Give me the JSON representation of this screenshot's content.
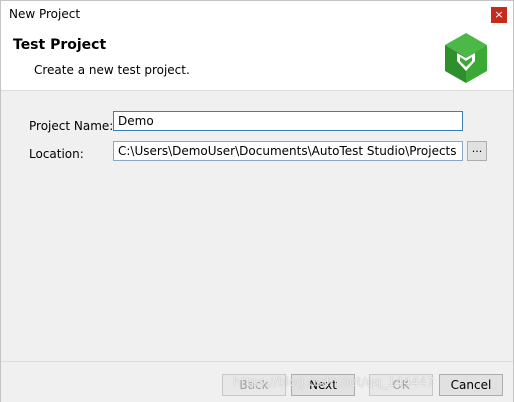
{
  "window": {
    "title": "New Project",
    "close_glyph": "×"
  },
  "header": {
    "title": "Test Project",
    "subtitle": "Create a new test project.",
    "logo_icon": "green-diamond-logo-icon",
    "logo_colors": [
      "#3aa935",
      "#2d8a2a",
      "#ffffff"
    ]
  },
  "form": {
    "project_name_label": "Project Name:",
    "project_name_value": "Demo",
    "location_label": "Location:",
    "location_value": "C:\\Users\\DemoUser\\Documents\\AutoTest Studio\\Projects",
    "browse_label": "..."
  },
  "footer": {
    "back_label": "Back",
    "next_label": "Next",
    "ok_label": "OK",
    "cancel_label": "Cancel"
  },
  "watermark": "https://blog.csdn.net/qq_144447"
}
